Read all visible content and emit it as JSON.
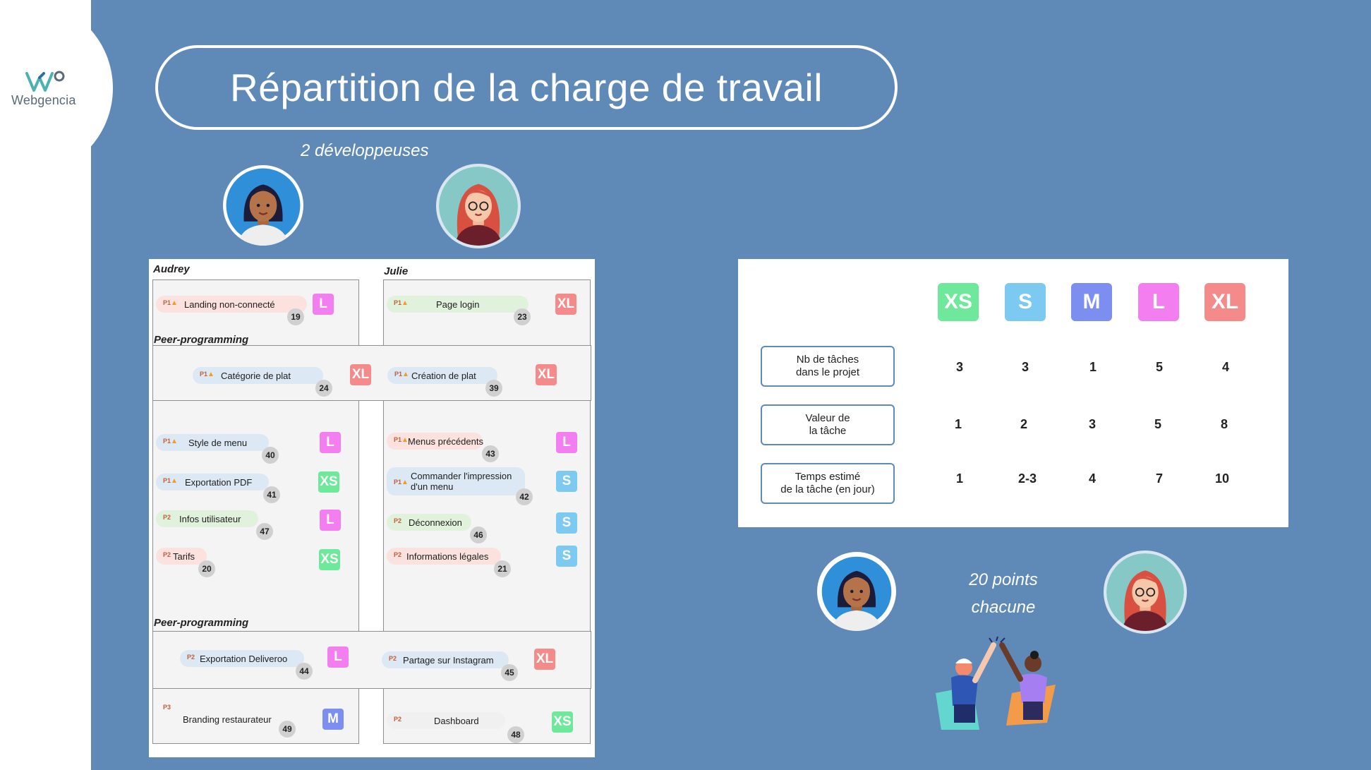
{
  "brand": {
    "name": "Webgencia"
  },
  "title": "Répartition de la charge de travail",
  "caption_devs": "2 développeuses",
  "caption_points": [
    "20 points",
    "chacune"
  ],
  "colors": {
    "background": "#5f8ab8",
    "XS": "#6ee89a",
    "S": "#7ccaf2",
    "M": "#7c8ef0",
    "L": "#f27ef0",
    "XL": "#f58a8a"
  },
  "board": {
    "audrey": "Audrey",
    "julie": "Julie",
    "peer1": "Peer-programming",
    "peer2": "Peer-programming",
    "cards": {
      "landing": {
        "prio": "P1",
        "label": "Landing non-connecté",
        "num": "19",
        "size": "L"
      },
      "login": {
        "prio": "P1",
        "label": "Page login",
        "num": "23",
        "size": "XL"
      },
      "categorie": {
        "prio": "P1",
        "label": "Catégorie de plat",
        "num": "24",
        "size": "XL"
      },
      "creation": {
        "prio": "P1",
        "label": "Création de plat",
        "num": "39",
        "size": "XL"
      },
      "style": {
        "prio": "P1",
        "label": "Style de menu",
        "num": "40",
        "size": "L"
      },
      "pdf": {
        "prio": "P1",
        "label": "Exportation PDF",
        "num": "41",
        "size": "XS"
      },
      "infos": {
        "prio": "P2",
        "label": "Infos utilisateur",
        "num": "47",
        "size": "L"
      },
      "tarifs": {
        "prio": "P2",
        "label": "Tarifs",
        "num": "20",
        "size": "XS"
      },
      "menus": {
        "prio": "P1",
        "label": "Menus précédents",
        "num": "43",
        "size": "L"
      },
      "impression": {
        "prio": "P1",
        "label": "Commander l'impression d'un menu",
        "num": "42",
        "size": "S"
      },
      "deconnexion": {
        "prio": "P2",
        "label": "Déconnexion",
        "num": "46",
        "size": "S"
      },
      "legales": {
        "prio": "P2",
        "label": "Informations légales",
        "num": "21",
        "size": "S"
      },
      "deliveroo": {
        "prio": "P2",
        "label": "Exportation Deliveroo",
        "num": "44",
        "size": "L"
      },
      "instagram": {
        "prio": "P2",
        "label": "Partage sur Instagram",
        "num": "45",
        "size": "XL"
      },
      "branding": {
        "prio": "P3",
        "label": "Branding restaurateur",
        "num": "49",
        "size": "M"
      },
      "dashboard": {
        "prio": "P2",
        "label": "Dashboard",
        "num": "48",
        "size": "XS"
      }
    }
  },
  "table": {
    "sizes": [
      "XS",
      "S",
      "M",
      "L",
      "XL"
    ],
    "rows": [
      {
        "label": [
          "Nb de tâches",
          "dans le projet"
        ],
        "values": [
          "3",
          "3",
          "1",
          "5",
          "4"
        ]
      },
      {
        "label": [
          "Valeur de",
          "la tâche"
        ],
        "values": [
          "1",
          "2",
          "3",
          "5",
          "8"
        ]
      },
      {
        "label": [
          "Temps estimé",
          "de la tâche (en jour)"
        ],
        "values": [
          "1",
          "2-3",
          "4",
          "7",
          "10"
        ]
      }
    ]
  },
  "icons": {
    "logo": "webgencia-logo-icon",
    "priority": "flame-icon",
    "illustration": "high-five-illustration"
  }
}
